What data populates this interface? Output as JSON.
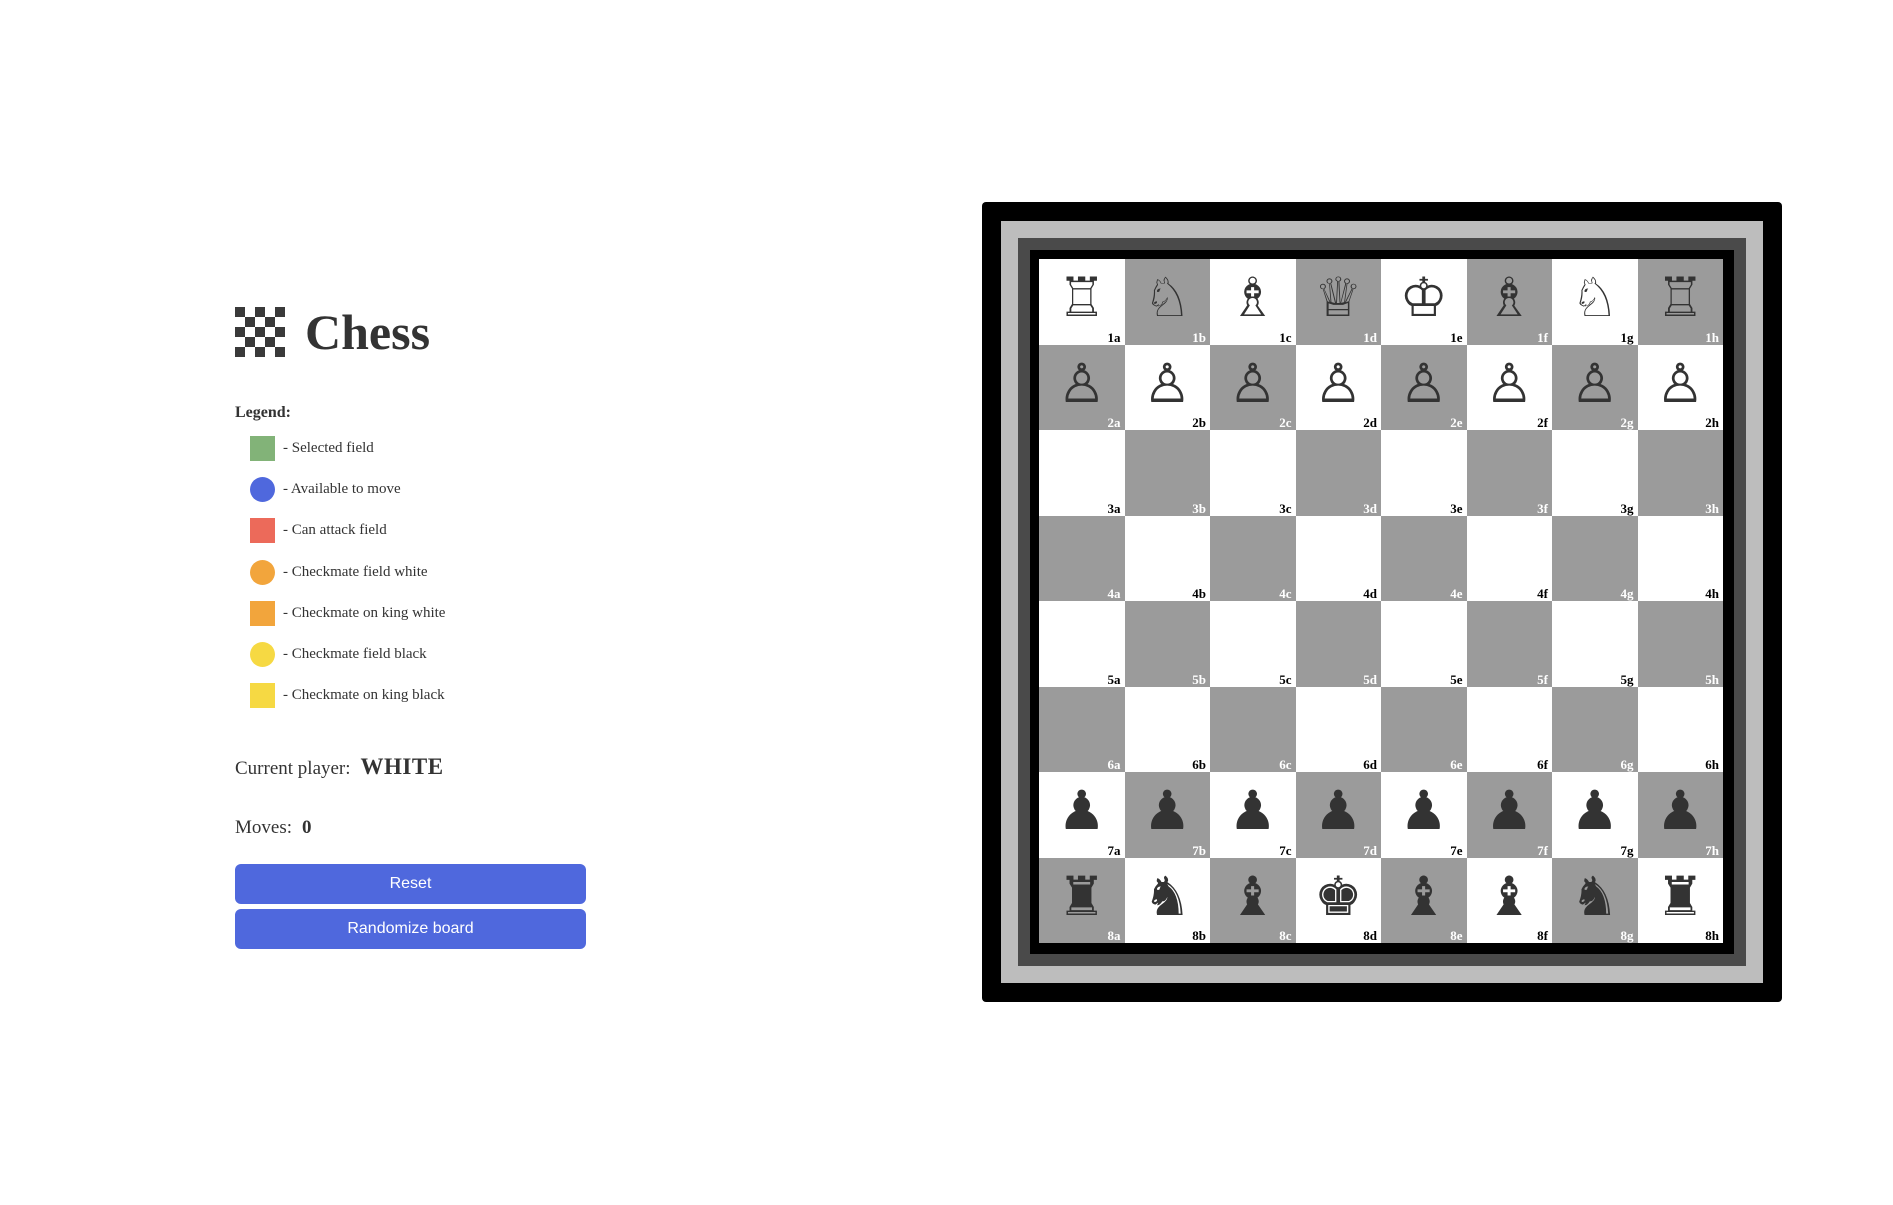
{
  "app": {
    "title": "Chess"
  },
  "legend": {
    "title": "Legend:",
    "items": [
      {
        "label": "- Selected field",
        "shape": "square",
        "color": "#82b378"
      },
      {
        "label": "- Available to move",
        "shape": "circle",
        "color": "#4f68dd"
      },
      {
        "label": "- Can attack field",
        "shape": "square",
        "color": "#ec6a5a"
      },
      {
        "label": "- Checkmate field white",
        "shape": "circle",
        "color": "#f2a53c"
      },
      {
        "label": "- Checkmate on king white",
        "shape": "square",
        "color": "#f2a53c"
      },
      {
        "label": "- Checkmate field black",
        "shape": "circle",
        "color": "#f6d943"
      },
      {
        "label": "- Checkmate on king black",
        "shape": "square",
        "color": "#f6d943"
      }
    ]
  },
  "status": {
    "current_player_label": "Current player:",
    "current_player": "WHITE",
    "moves_label": "Moves:",
    "moves": "0"
  },
  "buttons": {
    "reset": "Reset",
    "randomize": "Randomize board"
  },
  "board": {
    "colors": {
      "light": "#ffffff",
      "dark": "#9b9b9b"
    },
    "ranks": [
      {
        "squares": [
          {
            "coord": "1a",
            "shade": "light",
            "piece": "white-rook",
            "glyph": "♖"
          },
          {
            "coord": "1b",
            "shade": "dark",
            "piece": "white-knight",
            "glyph": "♘"
          },
          {
            "coord": "1c",
            "shade": "light",
            "piece": "white-bishop",
            "glyph": "♗"
          },
          {
            "coord": "1d",
            "shade": "dark",
            "piece": "white-queen",
            "glyph": "♕"
          },
          {
            "coord": "1e",
            "shade": "light",
            "piece": "white-king",
            "glyph": "♔"
          },
          {
            "coord": "1f",
            "shade": "dark",
            "piece": "white-bishop",
            "glyph": "♗"
          },
          {
            "coord": "1g",
            "shade": "light",
            "piece": "white-knight",
            "glyph": "♘"
          },
          {
            "coord": "1h",
            "shade": "dark",
            "piece": "white-rook",
            "glyph": "♖"
          }
        ]
      },
      {
        "squares": [
          {
            "coord": "2a",
            "shade": "dark",
            "piece": "white-pawn",
            "glyph": "♙"
          },
          {
            "coord": "2b",
            "shade": "light",
            "piece": "white-pawn",
            "glyph": "♙"
          },
          {
            "coord": "2c",
            "shade": "dark",
            "piece": "white-pawn",
            "glyph": "♙"
          },
          {
            "coord": "2d",
            "shade": "light",
            "piece": "white-pawn",
            "glyph": "♙"
          },
          {
            "coord": "2e",
            "shade": "dark",
            "piece": "white-pawn",
            "glyph": "♙"
          },
          {
            "coord": "2f",
            "shade": "light",
            "piece": "white-pawn",
            "glyph": "♙"
          },
          {
            "coord": "2g",
            "shade": "dark",
            "piece": "white-pawn",
            "glyph": "♙"
          },
          {
            "coord": "2h",
            "shade": "light",
            "piece": "white-pawn",
            "glyph": "♙"
          }
        ]
      },
      {
        "squares": [
          {
            "coord": "3a",
            "shade": "light",
            "piece": "",
            "glyph": ""
          },
          {
            "coord": "3b",
            "shade": "dark",
            "piece": "",
            "glyph": ""
          },
          {
            "coord": "3c",
            "shade": "light",
            "piece": "",
            "glyph": ""
          },
          {
            "coord": "3d",
            "shade": "dark",
            "piece": "",
            "glyph": ""
          },
          {
            "coord": "3e",
            "shade": "light",
            "piece": "",
            "glyph": ""
          },
          {
            "coord": "3f",
            "shade": "dark",
            "piece": "",
            "glyph": ""
          },
          {
            "coord": "3g",
            "shade": "light",
            "piece": "",
            "glyph": ""
          },
          {
            "coord": "3h",
            "shade": "dark",
            "piece": "",
            "glyph": ""
          }
        ]
      },
      {
        "squares": [
          {
            "coord": "4a",
            "shade": "dark",
            "piece": "",
            "glyph": ""
          },
          {
            "coord": "4b",
            "shade": "light",
            "piece": "",
            "glyph": ""
          },
          {
            "coord": "4c",
            "shade": "dark",
            "piece": "",
            "glyph": ""
          },
          {
            "coord": "4d",
            "shade": "light",
            "piece": "",
            "glyph": ""
          },
          {
            "coord": "4e",
            "shade": "dark",
            "piece": "",
            "glyph": ""
          },
          {
            "coord": "4f",
            "shade": "light",
            "piece": "",
            "glyph": ""
          },
          {
            "coord": "4g",
            "shade": "dark",
            "piece": "",
            "glyph": ""
          },
          {
            "coord": "4h",
            "shade": "light",
            "piece": "",
            "glyph": ""
          }
        ]
      },
      {
        "squares": [
          {
            "coord": "5a",
            "shade": "light",
            "piece": "",
            "glyph": ""
          },
          {
            "coord": "5b",
            "shade": "dark",
            "piece": "",
            "glyph": ""
          },
          {
            "coord": "5c",
            "shade": "light",
            "piece": "",
            "glyph": ""
          },
          {
            "coord": "5d",
            "shade": "dark",
            "piece": "",
            "glyph": ""
          },
          {
            "coord": "5e",
            "shade": "light",
            "piece": "",
            "glyph": ""
          },
          {
            "coord": "5f",
            "shade": "dark",
            "piece": "",
            "glyph": ""
          },
          {
            "coord": "5g",
            "shade": "light",
            "piece": "",
            "glyph": ""
          },
          {
            "coord": "5h",
            "shade": "dark",
            "piece": "",
            "glyph": ""
          }
        ]
      },
      {
        "squares": [
          {
            "coord": "6a",
            "shade": "dark",
            "piece": "",
            "glyph": ""
          },
          {
            "coord": "6b",
            "shade": "light",
            "piece": "",
            "glyph": ""
          },
          {
            "coord": "6c",
            "shade": "dark",
            "piece": "",
            "glyph": ""
          },
          {
            "coord": "6d",
            "shade": "light",
            "piece": "",
            "glyph": ""
          },
          {
            "coord": "6e",
            "shade": "dark",
            "piece": "",
            "glyph": ""
          },
          {
            "coord": "6f",
            "shade": "light",
            "piece": "",
            "glyph": ""
          },
          {
            "coord": "6g",
            "shade": "dark",
            "piece": "",
            "glyph": ""
          },
          {
            "coord": "6h",
            "shade": "light",
            "piece": "",
            "glyph": ""
          }
        ]
      },
      {
        "squares": [
          {
            "coord": "7a",
            "shade": "light",
            "piece": "black-pawn",
            "glyph": "♟"
          },
          {
            "coord": "7b",
            "shade": "dark",
            "piece": "black-pawn",
            "glyph": "♟"
          },
          {
            "coord": "7c",
            "shade": "light",
            "piece": "black-pawn",
            "glyph": "♟"
          },
          {
            "coord": "7d",
            "shade": "dark",
            "piece": "black-pawn",
            "glyph": "♟"
          },
          {
            "coord": "7e",
            "shade": "light",
            "piece": "black-pawn",
            "glyph": "♟"
          },
          {
            "coord": "7f",
            "shade": "dark",
            "piece": "black-pawn",
            "glyph": "♟"
          },
          {
            "coord": "7g",
            "shade": "light",
            "piece": "black-pawn",
            "glyph": "♟"
          },
          {
            "coord": "7h",
            "shade": "dark",
            "piece": "black-pawn",
            "glyph": "♟"
          }
        ]
      },
      {
        "squares": [
          {
            "coord": "8a",
            "shade": "dark",
            "piece": "black-rook",
            "glyph": "♜"
          },
          {
            "coord": "8b",
            "shade": "light",
            "piece": "black-knight",
            "glyph": "♞"
          },
          {
            "coord": "8c",
            "shade": "dark",
            "piece": "black-bishop",
            "glyph": "♝"
          },
          {
            "coord": "8d",
            "shade": "light",
            "piece": "black-king",
            "glyph": "♚"
          },
          {
            "coord": "8e",
            "shade": "dark",
            "piece": "black-bishop",
            "glyph": "♝"
          },
          {
            "coord": "8f",
            "shade": "light",
            "piece": "black-bishop",
            "glyph": "♝"
          },
          {
            "coord": "8g",
            "shade": "dark",
            "piece": "black-knight",
            "glyph": "♞"
          },
          {
            "coord": "8h",
            "shade": "light",
            "piece": "black-rook",
            "glyph": "♜"
          }
        ]
      }
    ]
  }
}
